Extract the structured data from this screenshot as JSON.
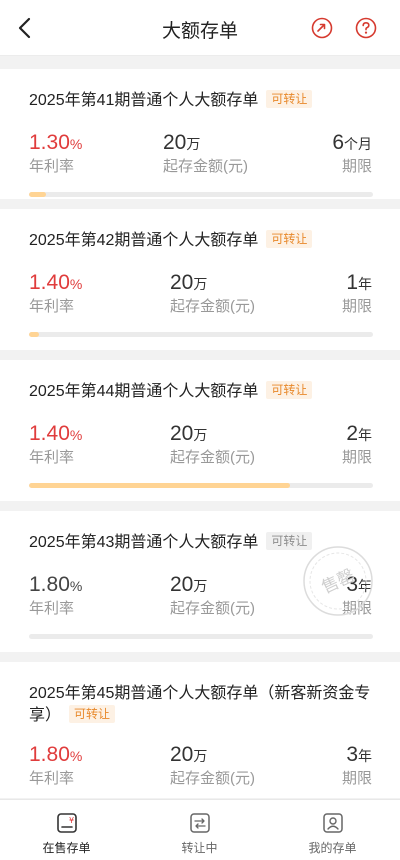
{
  "header": {
    "title": "大额存单",
    "back_icon": "back-chevron-icon",
    "share_icon": "share-icon",
    "help_icon": "help-icon"
  },
  "labels": {
    "rate": "年利率",
    "amount": "起存金额(元)",
    "term": "期限"
  },
  "products": [
    {
      "name": "2025年第41期普通个人大额存单",
      "tag": "可转让",
      "tag_state": "active",
      "rate": "1.30",
      "rate_unit": "%",
      "amount": "20",
      "amount_unit": "万",
      "term": "6",
      "term_unit": "个月",
      "progress": 0.05,
      "sold_out": false
    },
    {
      "name": "2025年第42期普通个人大额存单",
      "tag": "可转让",
      "tag_state": "active",
      "rate": "1.40",
      "rate_unit": "%",
      "amount": "20",
      "amount_unit": "万",
      "term": "1",
      "term_unit": "年",
      "progress": 0.03,
      "sold_out": false
    },
    {
      "name": "2025年第44期普通个人大额存单",
      "tag": "可转让",
      "tag_state": "active",
      "rate": "1.40",
      "rate_unit": "%",
      "amount": "20",
      "amount_unit": "万",
      "term": "2",
      "term_unit": "年",
      "progress": 0.76,
      "sold_out": false
    },
    {
      "name": "2025年第43期普通个人大额存单",
      "tag": "可转让",
      "tag_state": "inactive",
      "rate": "1.80",
      "rate_unit": "%",
      "amount": "20",
      "amount_unit": "万",
      "term": "3",
      "term_unit": "年",
      "progress": 0,
      "sold_out": true,
      "sold_out_stamp": "售罄"
    },
    {
      "name_line1": "2025年第45期普通个人大额存单（新客新资金专",
      "name_line2": "享）",
      "tag": "可转让",
      "tag_state": "active",
      "rate": "1.80",
      "rate_unit": "%",
      "amount": "20",
      "amount_unit": "万",
      "term": "3",
      "term_unit": "年",
      "sold_out": false
    }
  ],
  "colors": {
    "rate_red": "#e03c3c",
    "tag_orange": "#e8892b",
    "progress_fill": "#ffd494"
  },
  "tabbar": [
    {
      "label": "在售存单",
      "icon": "deposit-certificate-icon",
      "active": true
    },
    {
      "label": "转让中",
      "icon": "transfer-icon",
      "active": false
    },
    {
      "label": "我的存单",
      "icon": "my-deposit-icon",
      "active": false
    }
  ]
}
